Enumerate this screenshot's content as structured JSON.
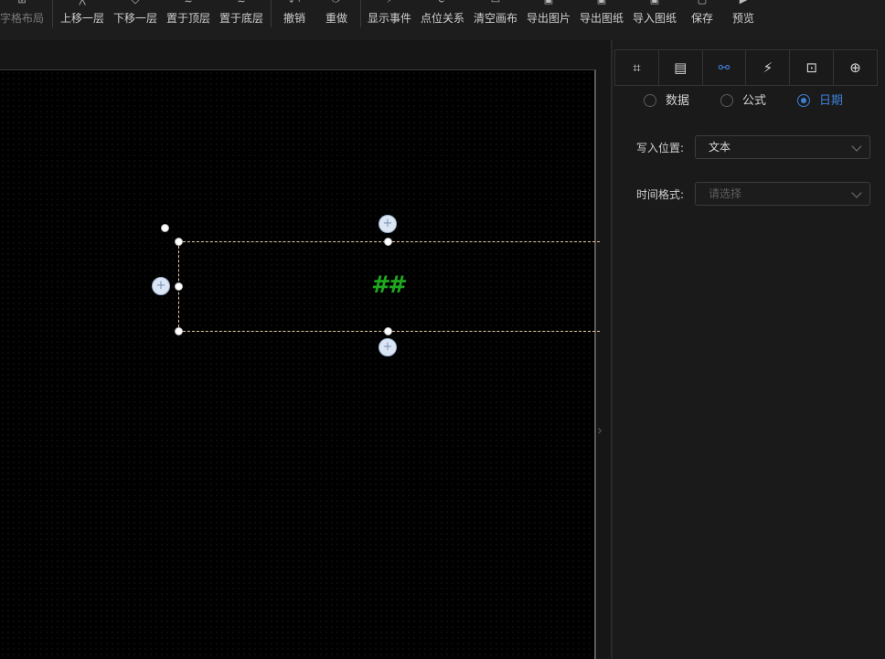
{
  "toolbar": {
    "items": [
      {
        "label": "字格布局",
        "icon": "grid-icon",
        "dim": true
      },
      {
        "label": "上移一层",
        "icon": "arrow-up-icon"
      },
      {
        "label": "下移一层",
        "icon": "arrow-down-icon"
      },
      {
        "label": "置于顶层",
        "icon": "layers-top-icon"
      },
      {
        "label": "置于底层",
        "icon": "layers-bottom-icon"
      },
      {
        "label": "撤销",
        "icon": "undo-icon"
      },
      {
        "label": "重做",
        "icon": "redo-icon"
      },
      {
        "label": "显示事件",
        "icon": "lightning-icon"
      },
      {
        "label": "点位关系",
        "icon": "relation-icon"
      },
      {
        "label": "清空画布",
        "icon": "trash-icon"
      },
      {
        "label": "导出图片",
        "icon": "export-image-icon"
      },
      {
        "label": "导出图纸",
        "icon": "export-drawing-icon"
      },
      {
        "label": "导入图纸",
        "icon": "import-drawing-icon"
      },
      {
        "label": "保存",
        "icon": "save-icon"
      },
      {
        "label": "预览",
        "icon": "play-icon"
      }
    ]
  },
  "canvas": {
    "element_text": "##",
    "element_color": "#1fa81f",
    "selection_border_color": "#e6c9a3"
  },
  "panel": {
    "tabs": [
      {
        "icon": "node-frame-icon"
      },
      {
        "icon": "document-settings-icon"
      },
      {
        "icon": "data-link-icon",
        "active": true
      },
      {
        "icon": "lightning-icon"
      },
      {
        "icon": "layout-icon"
      },
      {
        "icon": "target-icon"
      }
    ],
    "radios": [
      {
        "label": "数据",
        "checked": false
      },
      {
        "label": "公式",
        "checked": false
      },
      {
        "label": "日期",
        "checked": true
      }
    ],
    "write_position": {
      "label": "写入位置:",
      "value": "文本"
    },
    "time_format": {
      "label": "时间格式:",
      "placeholder": "请选择"
    },
    "accent_color": "#3e7fd6"
  }
}
